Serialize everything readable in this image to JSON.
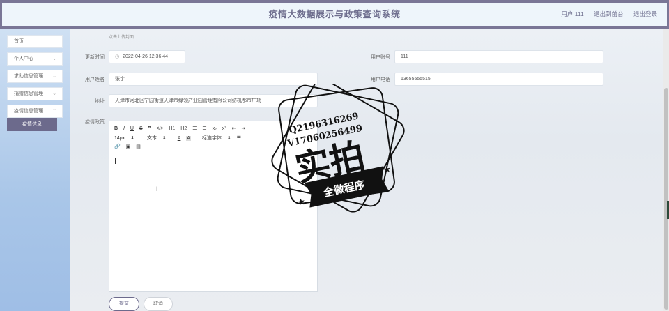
{
  "app": {
    "title": "疫情大数据展示与政策查询系统"
  },
  "header": {
    "user": "用户 111",
    "back_to_front": "退出到前台",
    "logout": "退出登录"
  },
  "sidebar": {
    "items": [
      {
        "label": "首页",
        "has_chevron": false
      },
      {
        "label": "个人中心",
        "has_chevron": true
      },
      {
        "label": "求助信息管理",
        "has_chevron": true
      },
      {
        "label": "捐赠信息管理",
        "has_chevron": true
      },
      {
        "label": "疫情信息管理",
        "has_chevron": true
      }
    ],
    "active_sub": "疫情信息"
  },
  "form": {
    "upload_hint": "点击上传封面",
    "update_time": {
      "label": "更新时间",
      "value": "2022-04-26 12:36:44"
    },
    "account": {
      "label": "用户账号",
      "value": "111"
    },
    "name": {
      "label": "用户姓名",
      "value": "张宇"
    },
    "phone": {
      "label": "用户电话",
      "value": "13655555515"
    },
    "address": {
      "label": "地址",
      "value": "天津市河北区宁园街道天津市绿领产业园管理有限公司纺机都市广场"
    },
    "policy": {
      "label": "疫情政策"
    }
  },
  "editor": {
    "row1": [
      "B",
      "I",
      "U",
      "S",
      "❞",
      "</>",
      "H1",
      "H2",
      "☰",
      "☰",
      "x₂",
      "x²",
      "⇤",
      "⇥"
    ],
    "font_size": "14px",
    "font_text": "文本",
    "font_family": "标准字体"
  },
  "buttons": {
    "submit": "提交",
    "cancel": "取消"
  },
  "watermark": {
    "line1": "Q2196316269",
    "line2": "V17060256499",
    "main": "实拍",
    "ribbon": "全微程序"
  },
  "colors": {
    "header_border": "#7a7696",
    "accent": "#6c6a8c",
    "sidebar_top": "#cfe0f3",
    "sidebar_bottom": "#9fbee6"
  }
}
